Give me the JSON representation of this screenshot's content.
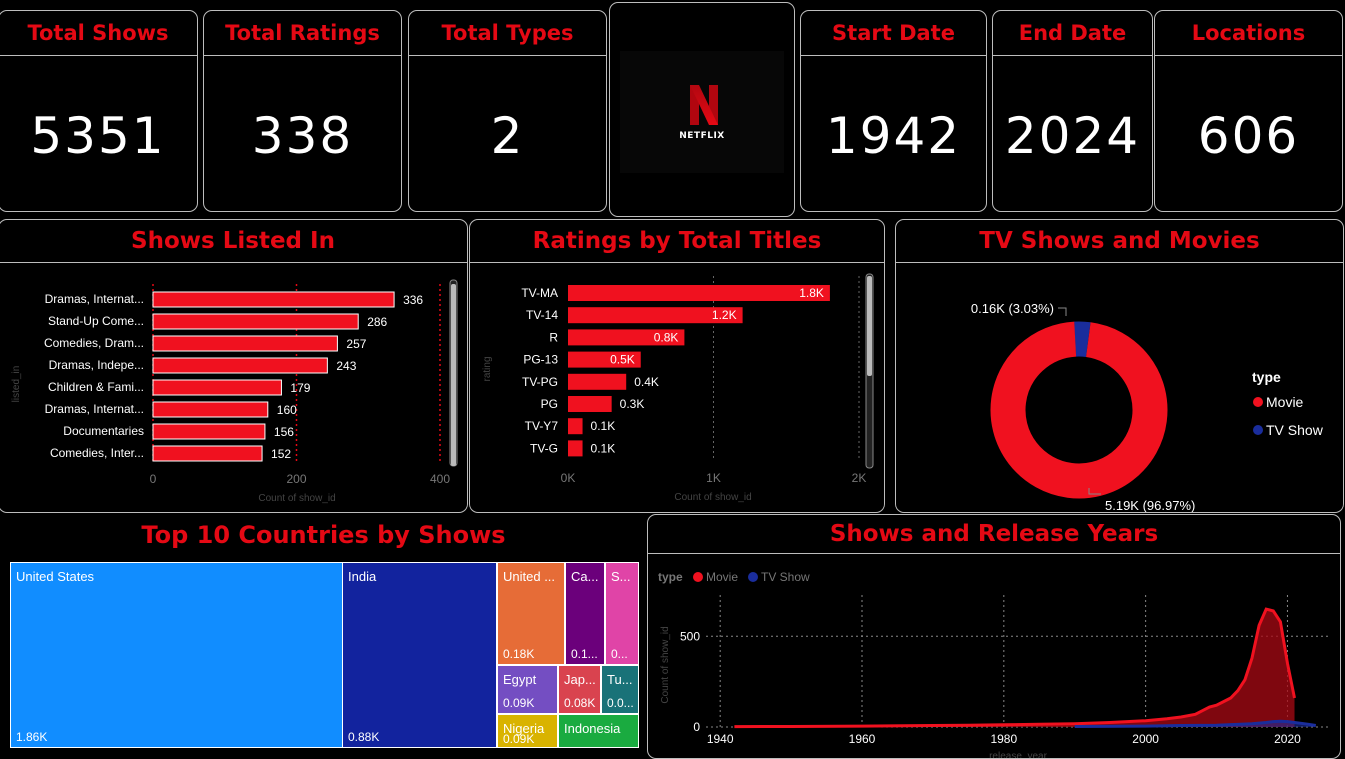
{
  "kpis": {
    "total_shows": {
      "title": "Total Shows",
      "value": "5351"
    },
    "total_ratings": {
      "title": "Total Ratings",
      "value": "338"
    },
    "total_types": {
      "title": "Total Types",
      "value": "2"
    },
    "start_date": {
      "title": "Start Date",
      "value": "1942"
    },
    "end_date": {
      "title": "End Date",
      "value": "2024"
    },
    "locations": {
      "title": "Locations",
      "value": "606"
    }
  },
  "logo": {
    "text": "NETFLIX",
    "color": "#e50914"
  },
  "colors": {
    "accent": "#e50914",
    "bar": "#f0111f",
    "movie": "#f0111f",
    "tvshow": "#1a2d9c",
    "grid": "#e50914"
  },
  "chart_data": [
    {
      "id": "listed_in",
      "type": "bar",
      "orientation": "horizontal",
      "title": "Shows Listed In",
      "xlabel": "Count of show_id",
      "ylabel": "listed_in",
      "categories": [
        "Dramas, Internat...",
        "Stand-Up Come...",
        "Comedies, Dram...",
        "Dramas, Indepe...",
        "Children & Fami...",
        "Dramas, Internat...",
        "Documentaries",
        "Comedies, Inter..."
      ],
      "values": [
        336,
        286,
        257,
        243,
        179,
        160,
        156,
        152
      ],
      "xticks": [
        "0",
        "200",
        "400"
      ],
      "xlim": [
        0,
        400
      ]
    },
    {
      "id": "ratings",
      "type": "bar",
      "orientation": "horizontal",
      "title": "Ratings by Total Titles",
      "xlabel": "Count of show_id",
      "ylabel": "rating",
      "categories": [
        "TV-MA",
        "TV-14",
        "R",
        "PG-13",
        "TV-PG",
        "PG",
        "TV-Y7",
        "TV-G"
      ],
      "values": [
        1800,
        1200,
        800,
        500,
        400,
        300,
        100,
        100
      ],
      "value_labels": [
        "1.8K",
        "1.2K",
        "0.8K",
        "0.5K",
        "0.4K",
        "0.3K",
        "0.1K",
        "0.1K"
      ],
      "xticks": [
        "0K",
        "1K",
        "2K"
      ],
      "xlim": [
        0,
        2000
      ]
    },
    {
      "id": "types",
      "type": "pie",
      "title": "TV Shows and Movies",
      "legend_title": "type",
      "legend_position": "right",
      "labels": [
        "Movie",
        "TV Show"
      ],
      "values": [
        5190,
        160
      ],
      "percents": [
        96.97,
        3.03
      ],
      "slice_labels": [
        "5.19K (96.97%)",
        "0.16K (3.03%)"
      ]
    },
    {
      "id": "countries",
      "type": "treemap",
      "title": "Top 10 Countries by Shows",
      "cells": [
        {
          "name": "United States",
          "label": "United States",
          "value_label": "1.86K",
          "color": "#118dff"
        },
        {
          "name": "India",
          "label": "India",
          "value_label": "0.88K",
          "color": "#12239e"
        },
        {
          "name": "United Kingdom",
          "label": "United ...",
          "value_label": "0.18K",
          "color": "#e66c37"
        },
        {
          "name": "Canada",
          "label": "Ca...",
          "value_label": "0.1...",
          "color": "#6b007b"
        },
        {
          "name": "Spain",
          "label": "S...",
          "value_label": "0...",
          "color": "#e044a7"
        },
        {
          "name": "Egypt",
          "label": "Egypt",
          "value_label": "0.09K",
          "color": "#744ec2"
        },
        {
          "name": "Japan",
          "label": "Jap...",
          "value_label": "0.08K",
          "color": "#d9434f"
        },
        {
          "name": "Turkey",
          "label": "Tu...",
          "value_label": "0.0...",
          "color": "#197278"
        },
        {
          "name": "Nigeria",
          "label": "Nigeria",
          "value_label": "0.09K",
          "color": "#d9b300"
        },
        {
          "name": "Indonesia",
          "label": "Indonesia",
          "value_label": "",
          "color": "#1aab40"
        }
      ]
    },
    {
      "id": "release_years",
      "type": "area",
      "title": "Shows and Release Years",
      "legend_title": "type",
      "legend_position": "top-left",
      "xlabel": "release_year",
      "ylabel": "Count of show_id",
      "xticks": [
        "1940",
        "1960",
        "1980",
        "2000",
        "2020"
      ],
      "yticks": [
        "0",
        "500"
      ],
      "xlim": [
        1938,
        2026
      ],
      "ylim": [
        0,
        700
      ],
      "series": [
        {
          "name": "Movie",
          "x": [
            1942,
            1950,
            1960,
            1970,
            1975,
            1980,
            1985,
            1990,
            1995,
            2000,
            2003,
            2005,
            2007,
            2008,
            2009,
            2010,
            2011,
            2012,
            2013,
            2014,
            2015,
            2016,
            2017,
            2018,
            2019,
            2020,
            2021
          ],
          "y": [
            2,
            3,
            5,
            8,
            10,
            12,
            15,
            18,
            25,
            35,
            45,
            55,
            70,
            90,
            110,
            120,
            140,
            160,
            200,
            260,
            380,
            560,
            650,
            640,
            580,
            350,
            160
          ]
        },
        {
          "name": "TV Show",
          "x": [
            1990,
            2000,
            2005,
            2010,
            2015,
            2017,
            2018,
            2019,
            2020,
            2021,
            2023,
            2024
          ],
          "y": [
            3,
            5,
            8,
            10,
            18,
            25,
            30,
            32,
            30,
            25,
            15,
            8
          ]
        }
      ]
    }
  ]
}
